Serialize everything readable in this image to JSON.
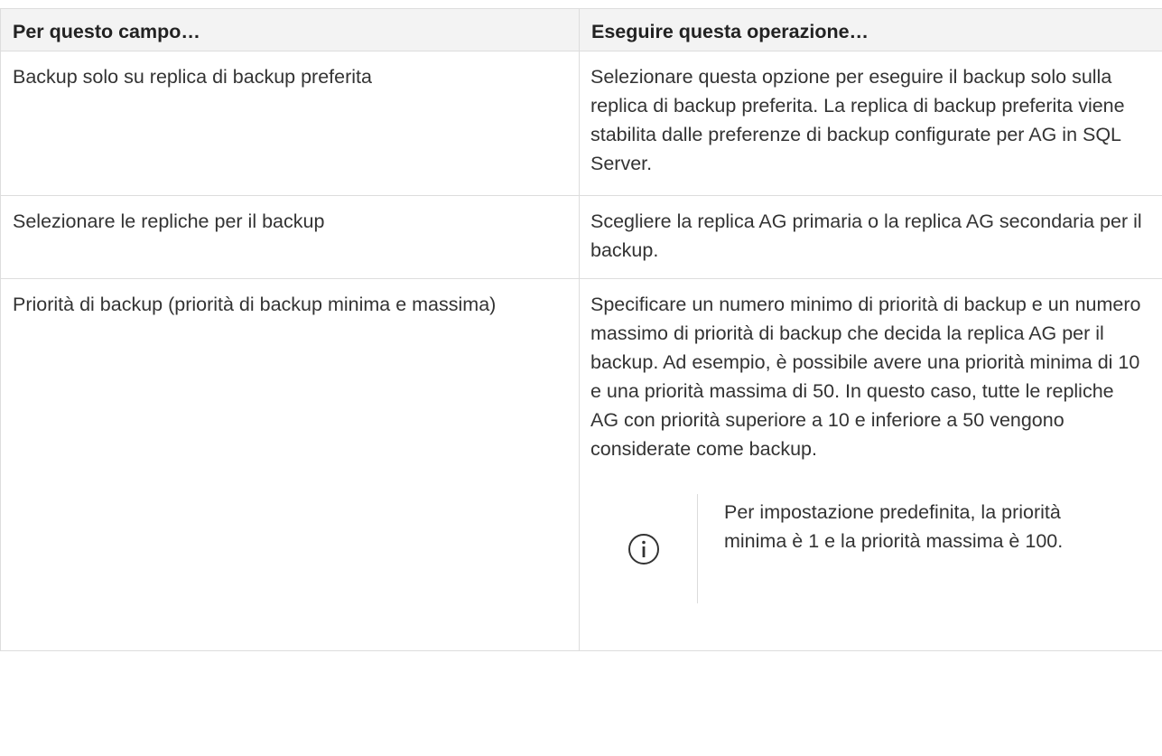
{
  "table": {
    "headers": [
      "Per questo campo…",
      "Eseguire questa operazione…"
    ],
    "rows": [
      {
        "field": "Backup solo su replica di backup preferita",
        "action": "Selezionare questa opzione per eseguire il backup solo sulla replica di backup preferita. La replica di backup preferita viene stabilita dalle preferenze di backup configurate per AG in SQL Server."
      },
      {
        "field": "Selezionare le repliche per il backup",
        "action": "Scegliere la replica AG primaria o la replica AG secondaria per il backup."
      },
      {
        "field": "Priorità di backup (priorità di backup minima e massima)",
        "action": "Specificare un numero minimo di priorità di backup e un numero massimo di priorità di backup che decida la replica AG per il backup. Ad esempio, è possibile avere una priorità minima di 10 e una priorità massima di 50. In questo caso, tutte le repliche AG con priorità superiore a 10 e inferiore a 50 vengono considerate come backup.",
        "note": {
          "icon": "info-icon",
          "text": "Per impostazione predefinita, la priorità minima è 1 e la priorità massima è 100."
        }
      }
    ]
  },
  "colors": {
    "border": "#dddddd",
    "header_bg": "#f3f3f3",
    "text": "#333333"
  }
}
